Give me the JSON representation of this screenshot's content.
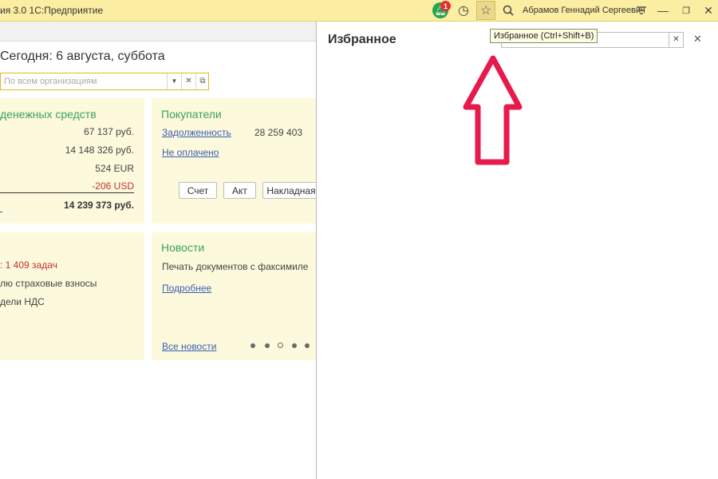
{
  "titlebar": {
    "app_title": "ия 3.0 1С:Предприятие",
    "notifications_count": "1",
    "user_name": "Абрамов Геннадий Сергеевич"
  },
  "home": {
    "date_title": "Сегодня: 6 августа, суббота",
    "org_placeholder": "По всем организациям"
  },
  "money": {
    "title": "денежных средств",
    "rows": [
      "67 137 руб.",
      "14 148 326 руб.",
      "524 EUR",
      "-206 USD"
    ],
    "total": "14 239 373 руб."
  },
  "buyers": {
    "title": "Покупатели",
    "debt_label": "Задолженность",
    "debt_value": "28 259 403",
    "unpaid_label": "Не оплачено",
    "buttons": [
      "Счет",
      "Акт",
      "Накладная"
    ]
  },
  "tasks": {
    "count_text": ": 1 409 задач",
    "item1": "лю страховые взносы",
    "item2": "дели НДС"
  },
  "news": {
    "title": "Новости",
    "headline": "Печать документов с факсимиле",
    "more_link": "Подробнее",
    "all_news_link": "Все новости"
  },
  "favorites": {
    "title": "Избранное",
    "tooltip": "Избранное (Ctrl+Shift+B)"
  },
  "colors": {
    "titlebar_bg": "#fbeda1",
    "panel_bg": "#fdf9dc",
    "panel_title": "#3aa35a",
    "link": "#3a5fb5",
    "negative": "#c0332f",
    "arrow": "#e8194b",
    "highlight_border": "#e8b81a"
  },
  "icons": [
    "bell-icon",
    "history-icon",
    "star-icon",
    "search-icon",
    "menu-icon",
    "minimize-icon",
    "maximize-icon",
    "close-icon"
  ]
}
